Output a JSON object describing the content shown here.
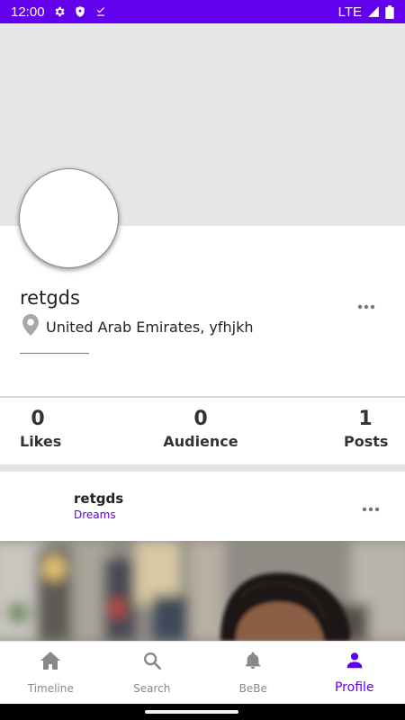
{
  "status_bar": {
    "time": "12:00",
    "network": "LTE",
    "icons": [
      "settings-icon",
      "shield-icon",
      "download-done-icon",
      "signal-icon",
      "battery-icon"
    ],
    "background": "#6200ee"
  },
  "profile": {
    "username": "retgds",
    "location": "United Arab Emirates, yfhjkh",
    "location_icon": "location-pin-icon",
    "more_icon": "more-horizontal-icon",
    "cover_color": "#e6e6e6"
  },
  "stats": [
    {
      "value": "0",
      "label": "Likes"
    },
    {
      "value": "0",
      "label": "Audience"
    },
    {
      "value": "1",
      "label": "Posts"
    }
  ],
  "post": {
    "author": "retgds",
    "category": "Dreams",
    "more_icon": "more-horizontal-icon"
  },
  "bottom_nav": {
    "items": [
      {
        "label": "Timeline",
        "icon": "home-icon",
        "active": false
      },
      {
        "label": "Search",
        "icon": "search-icon",
        "active": false
      },
      {
        "label": "BeBe",
        "icon": "bell-icon",
        "active": false
      },
      {
        "label": "Profile",
        "icon": "person-icon",
        "active": true
      }
    ],
    "accent_color": "#6200ee",
    "inactive_color": "#888888"
  }
}
